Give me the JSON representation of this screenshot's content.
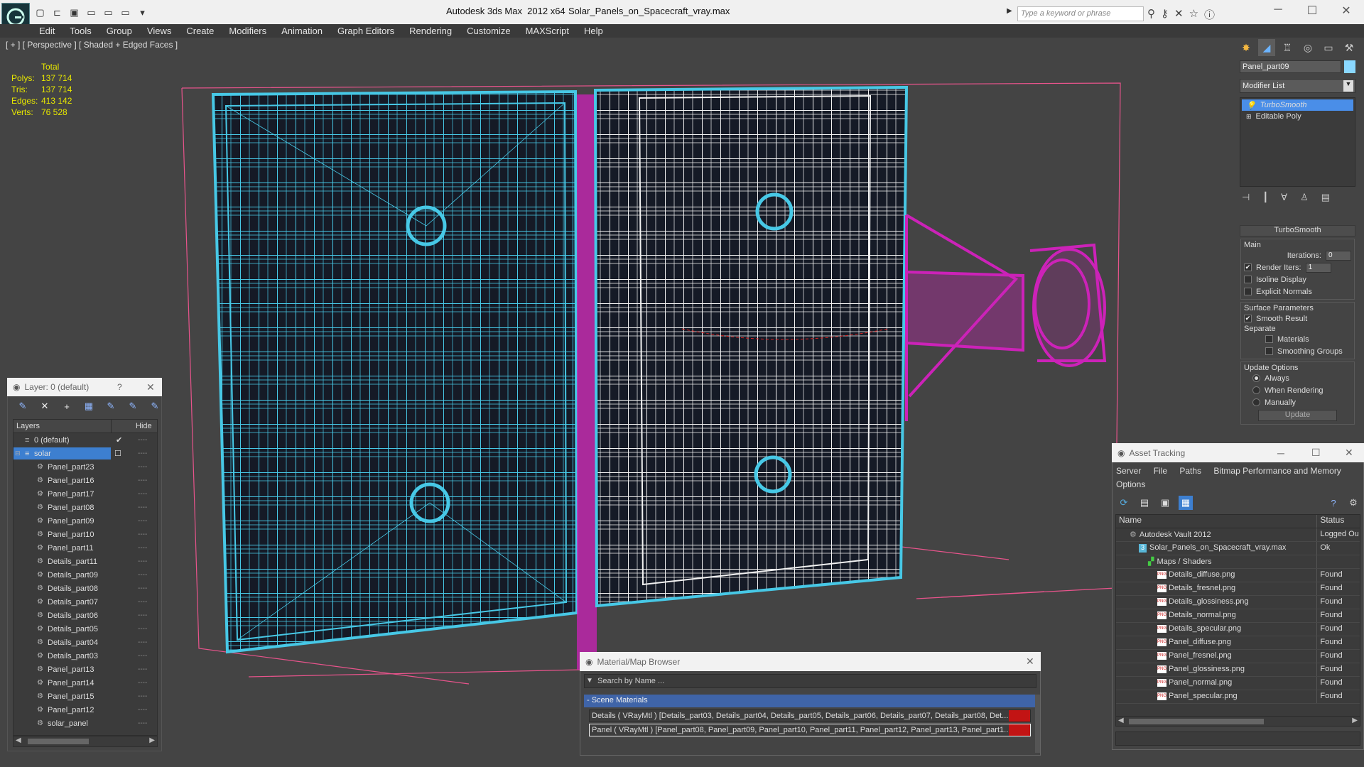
{
  "titlebar": {
    "app_title": "Autodesk 3ds Max  2012 x64",
    "file_title": "Solar_Panels_on_Spacecraft_vray.max",
    "search_placeholder": "Type a keyword or phrase"
  },
  "menu": [
    "Edit",
    "Tools",
    "Group",
    "Views",
    "Create",
    "Modifiers",
    "Animation",
    "Graph Editors",
    "Rendering",
    "Customize",
    "MAXScript",
    "Help"
  ],
  "viewport": {
    "label": "[ + ] [ Perspective ] [ Shaded + Edged Faces ]",
    "stats_header": "Total",
    "stats": [
      {
        "label": "Polys:",
        "value": "137 714"
      },
      {
        "label": "Tris:",
        "value": "137 714"
      },
      {
        "label": "Edges:",
        "value": "413 142"
      },
      {
        "label": "Verts:",
        "value": "76 528"
      }
    ],
    "colors": {
      "wire_cyan": "#47c8e6",
      "wire_white": "#f2f2f2",
      "wire_magenta": "#cc22b8",
      "box_pink": "#e8548c"
    }
  },
  "layer_manager": {
    "title": "Layer: 0 (default)",
    "help": "?",
    "columns": {
      "layers": "Layers",
      "hide": "Hide"
    },
    "layers": [
      {
        "name": "0 (default)",
        "indent": 1
      },
      {
        "name": "solar",
        "indent": 0,
        "selected": true
      }
    ],
    "objects": [
      "Panel_part23",
      "Panel_part16",
      "Panel_part17",
      "Panel_part08",
      "Panel_part09",
      "Panel_part10",
      "Panel_part11",
      "Details_part11",
      "Details_part09",
      "Details_part08",
      "Details_part07",
      "Details_part06",
      "Details_part05",
      "Details_part04",
      "Details_part03",
      "Panel_part13",
      "Panel_part14",
      "Panel_part15",
      "Panel_part12",
      "solar_panel"
    ],
    "hide_glyph": "----"
  },
  "command_panel": {
    "object_name": "Panel_part09",
    "modifier_list": "Modifier List",
    "stack": [
      "TurboSmooth",
      "Editable Poly"
    ],
    "rollout_title": "TurboSmooth",
    "main_label": "Main",
    "iterations_label": "Iterations:",
    "iterations_value": "0",
    "render_iters_label": "Render Iters:",
    "render_iters_value": "1",
    "isoline": "Isoline Display",
    "explicit": "Explicit Normals",
    "surface_params": "Surface Parameters",
    "smooth_result": "Smooth Result",
    "separate": "Separate",
    "materials": "Materials",
    "smoothing_groups": "Smoothing Groups",
    "update_options": "Update Options",
    "always": "Always",
    "when_rendering": "When Rendering",
    "manually": "Manually",
    "update_btn": "Update"
  },
  "asset_tracking": {
    "title": "Asset Tracking",
    "menu": [
      "Server",
      "File",
      "Paths",
      "Bitmap Performance and Memory",
      "Options"
    ],
    "columns": {
      "name": "Name",
      "status": "Status"
    },
    "rows": [
      {
        "name": "Autodesk Vault 2012",
        "status": "Logged Ou",
        "level": 1,
        "icon": "vault"
      },
      {
        "name": "Solar_Panels_on_Spacecraft_vray.max",
        "status": "Ok",
        "level": 2,
        "icon": "max"
      },
      {
        "name": "Maps / Shaders",
        "status": "",
        "level": 3,
        "icon": "maps"
      },
      {
        "name": "Details_diffuse.png",
        "status": "Found",
        "level": 4,
        "icon": "png"
      },
      {
        "name": "Details_fresnel.png",
        "status": "Found",
        "level": 4,
        "icon": "png"
      },
      {
        "name": "Details_glossiness.png",
        "status": "Found",
        "level": 4,
        "icon": "png"
      },
      {
        "name": "Details_normal.png",
        "status": "Found",
        "level": 4,
        "icon": "png"
      },
      {
        "name": "Details_specular.png",
        "status": "Found",
        "level": 4,
        "icon": "png"
      },
      {
        "name": "Panel_diffuse.png",
        "status": "Found",
        "level": 4,
        "icon": "png"
      },
      {
        "name": "Panel_fresnel.png",
        "status": "Found",
        "level": 4,
        "icon": "png"
      },
      {
        "name": "Panel_glossiness.png",
        "status": "Found",
        "level": 4,
        "icon": "png"
      },
      {
        "name": "Panel_normal.png",
        "status": "Found",
        "level": 4,
        "icon": "png"
      },
      {
        "name": "Panel_specular.png",
        "status": "Found",
        "level": 4,
        "icon": "png"
      }
    ]
  },
  "material_browser": {
    "title": "Material/Map Browser",
    "search_placeholder": "Search by Name ...",
    "group": "- Scene Materials",
    "rows": [
      "Details  ( VRayMtl ) [Details_part03, Details_part04, Details_part05, Details_part06, Details_part07, Details_part08, Det...",
      "Panel  ( VRayMtl )  [Panel_part08, Panel_part09, Panel_part10, Panel_part11, Panel_part12, Panel_part13, Panel_part1..."
    ]
  }
}
